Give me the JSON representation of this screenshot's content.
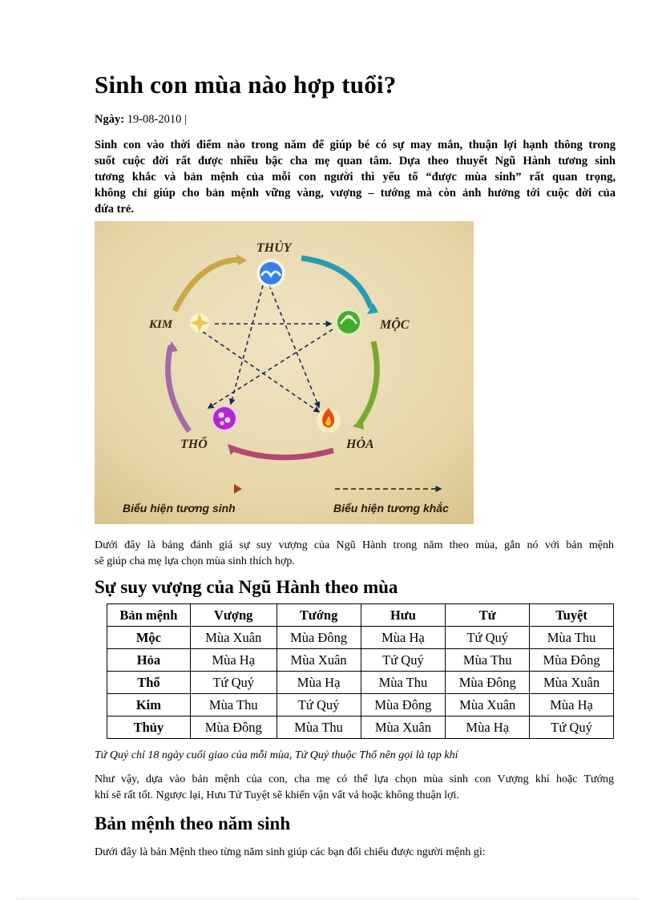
{
  "title": "Sinh con mùa nào hợp tuổi?",
  "date": {
    "label": "Ngày:",
    "value": "19-08-2010 |"
  },
  "intro_lines": [
    "Sinh con vào thời điểm nào trong năm để giúp bé có sự may mắn, thuận lợi hạnh thông trong",
    "suốt cuộc đời rất được nhiều bậc cha mẹ quan tâm. Dựa theo thuyết Ngũ Hành tương sinh",
    "tương khắc và bản mệnh của mỗi con người thì yếu tố “được mùa sinh” rất quan trọng,",
    "không chỉ giúp cho bản mệnh vững vàng, vượng – tướng mà còn ảnh hưởng tới cuộc đời của",
    "đứa trẻ."
  ],
  "figure": {
    "elements": {
      "water": "THỦY",
      "wood": "MỘC",
      "fire": "HỎA",
      "earth": "THỔ",
      "metal": "KIM"
    },
    "legend_generate": "Biểu hiện tương sinh",
    "legend_overcome": "Biểu hiện tương khắc",
    "colors": {
      "background": "#e9dcb3",
      "water": "#2a6fe0",
      "wood": "#3fae2a",
      "fire": "#e84a10",
      "earth": "#b02ad0",
      "metal": "#e8d870",
      "label": "#3a2510"
    }
  },
  "paragraph2_lines": [
    "Dưới đây là bảng đánh giá sự suy vượng của Ngũ Hành trong năm theo mùa, gắn nó với bản mệnh",
    "sẽ giúp cha mẹ lựa chọn mùa sinh thích hợp."
  ],
  "heading_seasons": "Sự suy vượng của Ngũ Hành theo mùa",
  "table": {
    "headers": [
      "Bản mệnh",
      "Vượng",
      "Tướng",
      "Hưu",
      "Tử",
      "Tuyệt"
    ],
    "rows": [
      [
        "Mộc",
        "Mùa Xuân",
        "Mùa Đông",
        "Mùa Hạ",
        "Tứ Quý",
        "Mùa Thu"
      ],
      [
        "Hỏa",
        "Mùa Hạ",
        "Mùa Xuân",
        "Tứ Quý",
        "Mùa Thu",
        "Mùa Đông"
      ],
      [
        "Thổ",
        "Tứ Quý",
        "Mùa Hạ",
        "Mùa Thu",
        "Mùa Đông",
        "Mùa Xuân"
      ],
      [
        "Kim",
        "Mùa Thu",
        "Tứ Quý",
        "Mùa Đông",
        "Mùa Xuân",
        "Mùa Hạ"
      ],
      [
        "Thủy",
        "Mùa Đông",
        "Mùa Thu",
        "Mùa Xuân",
        "Mùa Hạ",
        "Tứ Quý"
      ]
    ]
  },
  "table_note": "Tứ Quý chỉ 18 ngày cuối giao của mỗi mùa, Tứ Quý thuộc Thổ nên gọi là tạp khí",
  "paragraph3_lines": [
    "Như vậy, dựa vào bản mệnh của con, cha mẹ có thể lựa chọn mùa sinh con Vượng khí hoặc Tướng",
    "khí sẽ rất tốt. Ngược lại, Hưu Tử Tuyệt sẽ khiến vận vất vả hoặc không thuận lợi."
  ],
  "heading_birth": "Bản mệnh theo năm sinh",
  "paragraph4": "Dưới đây là bản Mệnh theo từng năm sinh giúp các bạn đối chiếu được người mệnh gì:"
}
